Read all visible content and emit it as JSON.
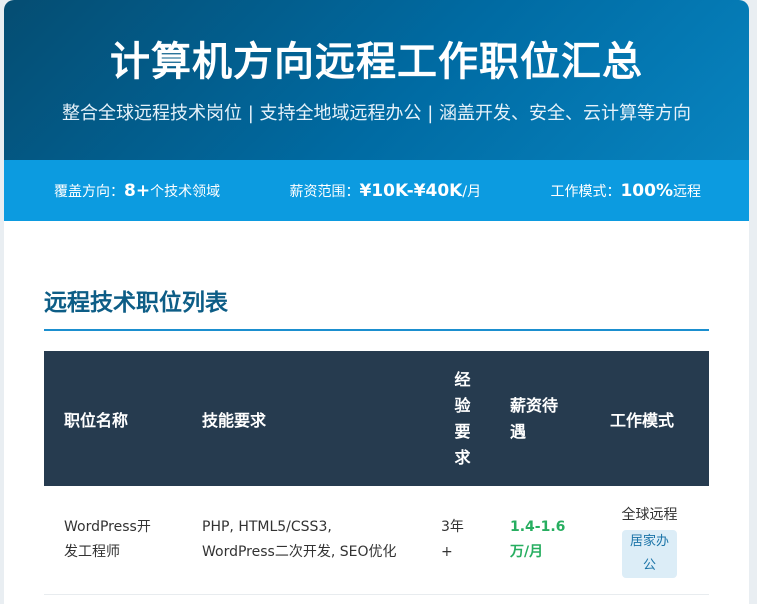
{
  "header": {
    "title": "计算机方向远程工作职位汇总",
    "subtitle": "整合全球远程技术岗位 | 支持全地域远程办公 | 涵盖开发、安全、云计算等方向"
  },
  "stats": [
    {
      "label": "覆盖方向：",
      "value": "8+",
      "unit": "个技术领域"
    },
    {
      "label": "薪资范围：",
      "value": "¥10K-¥40K",
      "unit": "/月"
    },
    {
      "label": "工作模式：",
      "value": "100%",
      "unit": "远程"
    }
  ],
  "section": {
    "title": "远程技术职位列表"
  },
  "table": {
    "headers": {
      "position": "职位名称",
      "skills": "技能要求",
      "experience": [
        "经",
        "验",
        "要",
        "求"
      ],
      "salary": [
        "薪资待",
        "遇"
      ],
      "mode": "工作模式"
    },
    "rows": [
      {
        "position": [
          "WordPress开",
          "发工程师"
        ],
        "skills": [
          "PHP, HTML5/CSS3,",
          "WordPress二次开发, SEO优化"
        ],
        "experience": [
          "3年",
          "+"
        ],
        "salary": [
          "1.4-1.6",
          "万/月"
        ],
        "mode": "全球远程",
        "badge": [
          "居家办",
          "公"
        ]
      }
    ]
  },
  "colors": {
    "hero_dark": "#054d72",
    "statbar": "#0c9be0",
    "table_header": "#263b4f",
    "salary": "#27ae60",
    "accent": "#1b8fcf"
  }
}
